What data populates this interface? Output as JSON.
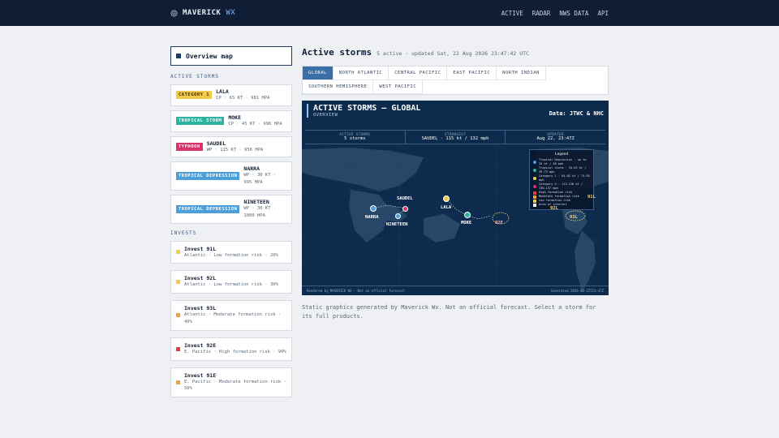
{
  "brand": {
    "name": "MAVERICK",
    "suffix": "WX"
  },
  "nav": [
    "ACTIVE",
    "RADAR",
    "NWS DATA",
    "API"
  ],
  "sidebar": {
    "overview_label": "Overview map",
    "active_label": "ACTIVE STORMS",
    "storms": [
      {
        "badge": "CATEGORY 1",
        "badge_bg": "#f2c94c",
        "badge_fg": "#3a2a00",
        "name": "LALA",
        "meta": "CP · 65 KT · 981 HPA"
      },
      {
        "badge": "TROPICAL STORM",
        "badge_bg": "#2bb3a0",
        "badge_fg": "#ffffff",
        "name": "MOKE",
        "meta": "CP · 45 KT · 996 HPA"
      },
      {
        "badge": "TYPHOON",
        "badge_bg": "#d6336c",
        "badge_fg": "#ffffff",
        "name": "SAUDEL",
        "meta": "WP · 115 KT · 956 HPA"
      },
      {
        "badge": "TROPICAL DEPRESSION",
        "badge_bg": "#4c9fd9",
        "badge_fg": "#ffffff",
        "name": "NARRA",
        "meta": "WP · 30 KT · 995 HPA"
      },
      {
        "badge": "TROPICAL DEPRESSION",
        "badge_bg": "#4c9fd9",
        "badge_fg": "#ffffff",
        "name": "NINETEEN",
        "meta": "WP · 30 KT · 1000 HPA"
      }
    ],
    "invests_label": "INVESTS",
    "invests": [
      {
        "name": "Invest 91L",
        "meta": "Atlantic · Low formation risk · 20%",
        "color": "#f2c94c"
      },
      {
        "name": "Invest 92L",
        "meta": "Atlantic · Low formation risk · 30%",
        "color": "#f2c94c"
      },
      {
        "name": "Invest 93L",
        "meta": "Atlantic · Moderate formation risk · 40%",
        "color": "#f0a03c"
      },
      {
        "name": "Invest 92E",
        "meta": "E. Pacific · High formation risk · 90%",
        "color": "#e03c3c"
      },
      {
        "name": "Invest 91E",
        "meta": "E. Pacific · Moderate formation risk · 50%",
        "color": "#f0a03c"
      }
    ]
  },
  "main": {
    "title": "Active storms",
    "subtitle": "5 active · updated Sat, 22 Aug 2026 23:47:42 UTC",
    "tabs": [
      "GLOBAL",
      "NORTH ATLANTIC",
      "CENTRAL PACIFIC",
      "EAST PACIFIC",
      "NORTH INDIAN",
      "SOUTHERN HEMISPHERE",
      "WEST PACIFIC"
    ],
    "caption": "Static graphics generated by Maverick Wx. Not an official forecast. Select a storm for its full products."
  },
  "map": {
    "title": "ACTIVE STORMS — GLOBAL",
    "subtitle": "OVERVIEW",
    "data_source": "Data: JTWC & NHC",
    "stats": [
      {
        "label": "ACTIVE STORMS",
        "value": "5 storms"
      },
      {
        "label": "STRONGEST",
        "value": "SAUDEL · 115 kt / 132 mph"
      },
      {
        "label": "UPDATED",
        "value": "Aug 22, 23:47Z"
      }
    ],
    "legend_title": "Legend",
    "legend": [
      {
        "label": "Tropical Depression · up to 33 kt / 38 mph",
        "color": "#4c9fd9"
      },
      {
        "label": "Tropical storm · 34-63 kt / 39-73 mph",
        "color": "#2bb3a0"
      },
      {
        "label": "Category 1 · 64-82 kt / 74-95 mph",
        "color": "#f2c94c"
      },
      {
        "label": "Category 4 · 113-136 kt / 130-157 mph",
        "color": "#d6336c"
      },
      {
        "label": "High formation risk",
        "color": "#e03c3c"
      },
      {
        "label": "Moderate formation risk",
        "color": "#f0a03c"
      },
      {
        "label": "Low formation risk",
        "color": "#f2c94c"
      },
      {
        "label": "Area of interest",
        "color": "#ffffff"
      }
    ],
    "labels": {
      "saudel": "SAUDEL",
      "narra": "NARRA",
      "nineteen": "NINETEEN",
      "lala": "LALA",
      "moke": "MOKE",
      "i91l": "91L",
      "i92l": "92L",
      "i93l": "93L",
      "i92e": "92E"
    },
    "footer_left": "Rendered by MAVERICK WX · Not an official forecast",
    "footer_right": "Generated 2026-08-22T23:47Z"
  }
}
